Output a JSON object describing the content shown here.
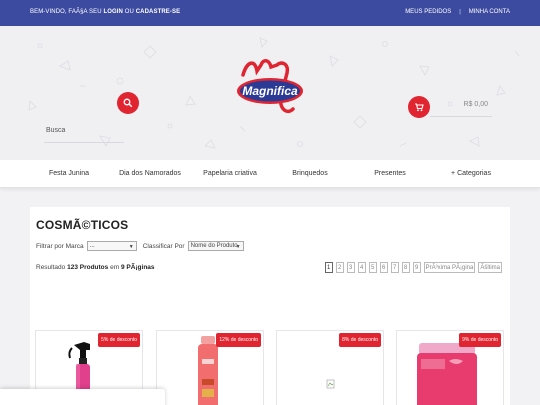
{
  "topbar": {
    "welcome_prefix": "BEM-VINDO, FAÃ§A SEU",
    "login": "LOGIN",
    "or": "OU",
    "signup": "CADASTRE-SE",
    "my_orders": "MEUS PEDIDOS",
    "separator": "|",
    "my_account": "MINHA CONTA",
    "bg_color": "#3c4ba0"
  },
  "header": {
    "search_placeholder": "Busca",
    "search_icon": "search-icon",
    "logo_text": "Magnifica",
    "cart_icon": "cart-icon",
    "cart_total": "R$ 0,00",
    "accent_color": "#e02531"
  },
  "nav": {
    "items": [
      "Festa Junina",
      "Dia dos Namorados",
      "Papelaria criativa",
      "Brinquedos",
      "Presentes",
      "+ Categorias"
    ]
  },
  "main": {
    "title": "COSMÃ©TICOS",
    "filter_brand_label": "Filtrar por Marca",
    "filter_brand_value": "...",
    "sort_label": "Classificar Por",
    "sort_value": "Nome do Produto",
    "result_prefix": "Resultado",
    "result_count": "123 Produtos",
    "result_in": "em",
    "result_pages": "9 PÃ¡ginas",
    "pages": [
      "1",
      "2",
      "3",
      "4",
      "5",
      "6",
      "7",
      "8",
      "9"
    ],
    "active_page": "1",
    "next_label": "PrÃ³xima PÃ¡gina",
    "last_label": "Ãšltima"
  },
  "products": [
    {
      "discount": "5% de desconto",
      "image": "hair-spray-bottle"
    },
    {
      "discount": "12% de desconto",
      "image": "shampoo-bottle"
    },
    {
      "discount": "8% de desconto",
      "image": "broken-image"
    },
    {
      "discount": "9% de desconto",
      "image": "cream-jar"
    }
  ]
}
